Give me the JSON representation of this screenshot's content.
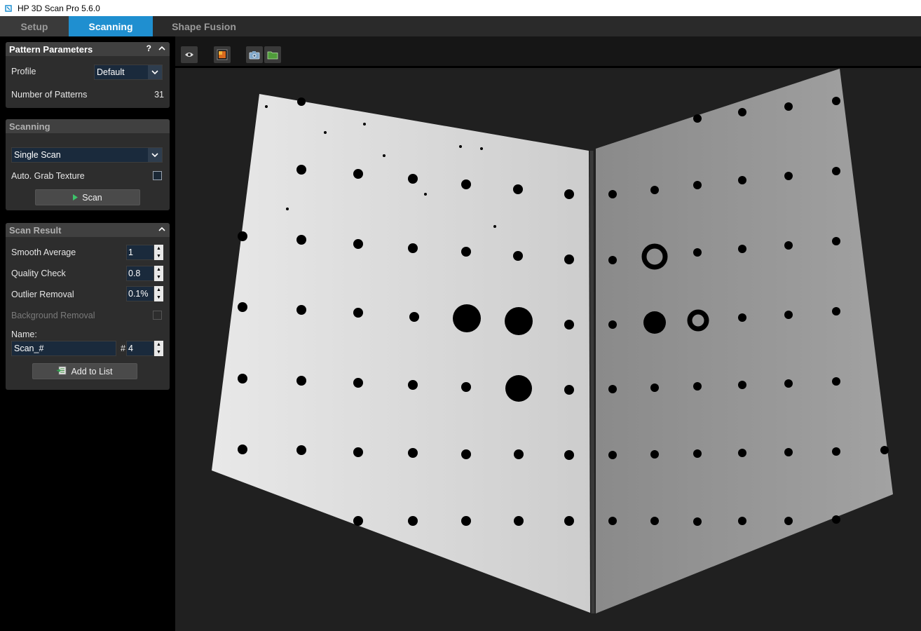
{
  "window": {
    "title": "HP 3D Scan Pro 5.6.0"
  },
  "tabs": [
    {
      "label": "Setup"
    },
    {
      "label": "Scanning"
    },
    {
      "label": "Shape Fusion"
    }
  ],
  "pattern_parameters": {
    "title": "Pattern Parameters",
    "help": "?",
    "profile_label": "Profile",
    "profile_value": "Default",
    "num_patterns_label": "Number of Patterns",
    "num_patterns_value": "31"
  },
  "scanning": {
    "title": "Scanning",
    "mode_value": "Single Scan",
    "auto_grab_label": "Auto. Grab Texture",
    "auto_grab_checked": false,
    "scan_button": "Scan"
  },
  "scan_result": {
    "title": "Scan Result",
    "smooth_average_label": "Smooth Average",
    "smooth_average_value": "1",
    "quality_check_label": "Quality Check",
    "quality_check_value": "0.8",
    "outlier_removal_label": "Outlier Removal",
    "outlier_removal_value": "0.1%",
    "background_removal_label": "Background Removal",
    "background_removal_checked": false,
    "name_label": "Name:",
    "name_value": "Scan_#",
    "number_prefix": "#",
    "number_value": "4",
    "add_button": "Add to List"
  },
  "colors": {
    "accent": "#1f8fd0",
    "panel_bg": "#2d2d2d",
    "viewport_bg": "#202020",
    "scan_left": "#d8d8d8",
    "scan_right": "#8c8c8c"
  },
  "icons": {
    "eye": "eye-icon",
    "texture": "texture-icon",
    "camera": "camera-icon",
    "folder": "folder-icon",
    "play": "play-icon",
    "add_to_list": "add-to-list-icon"
  }
}
